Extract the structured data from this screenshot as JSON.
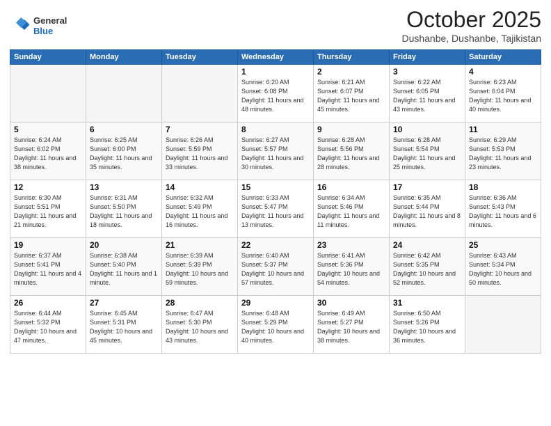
{
  "header": {
    "logo_line1": "General",
    "logo_line2": "Blue",
    "month_title": "October 2025",
    "location": "Dushanbe, Dushanbe, Tajikistan"
  },
  "days_of_week": [
    "Sunday",
    "Monday",
    "Tuesday",
    "Wednesday",
    "Thursday",
    "Friday",
    "Saturday"
  ],
  "weeks": [
    [
      {
        "day": "",
        "info": ""
      },
      {
        "day": "",
        "info": ""
      },
      {
        "day": "",
        "info": ""
      },
      {
        "day": "1",
        "info": "Sunrise: 6:20 AM\nSunset: 6:08 PM\nDaylight: 11 hours\nand 48 minutes."
      },
      {
        "day": "2",
        "info": "Sunrise: 6:21 AM\nSunset: 6:07 PM\nDaylight: 11 hours\nand 45 minutes."
      },
      {
        "day": "3",
        "info": "Sunrise: 6:22 AM\nSunset: 6:05 PM\nDaylight: 11 hours\nand 43 minutes."
      },
      {
        "day": "4",
        "info": "Sunrise: 6:23 AM\nSunset: 6:04 PM\nDaylight: 11 hours\nand 40 minutes."
      }
    ],
    [
      {
        "day": "5",
        "info": "Sunrise: 6:24 AM\nSunset: 6:02 PM\nDaylight: 11 hours\nand 38 minutes."
      },
      {
        "day": "6",
        "info": "Sunrise: 6:25 AM\nSunset: 6:00 PM\nDaylight: 11 hours\nand 35 minutes."
      },
      {
        "day": "7",
        "info": "Sunrise: 6:26 AM\nSunset: 5:59 PM\nDaylight: 11 hours\nand 33 minutes."
      },
      {
        "day": "8",
        "info": "Sunrise: 6:27 AM\nSunset: 5:57 PM\nDaylight: 11 hours\nand 30 minutes."
      },
      {
        "day": "9",
        "info": "Sunrise: 6:28 AM\nSunset: 5:56 PM\nDaylight: 11 hours\nand 28 minutes."
      },
      {
        "day": "10",
        "info": "Sunrise: 6:28 AM\nSunset: 5:54 PM\nDaylight: 11 hours\nand 25 minutes."
      },
      {
        "day": "11",
        "info": "Sunrise: 6:29 AM\nSunset: 5:53 PM\nDaylight: 11 hours\nand 23 minutes."
      }
    ],
    [
      {
        "day": "12",
        "info": "Sunrise: 6:30 AM\nSunset: 5:51 PM\nDaylight: 11 hours\nand 21 minutes."
      },
      {
        "day": "13",
        "info": "Sunrise: 6:31 AM\nSunset: 5:50 PM\nDaylight: 11 hours\nand 18 minutes."
      },
      {
        "day": "14",
        "info": "Sunrise: 6:32 AM\nSunset: 5:49 PM\nDaylight: 11 hours\nand 16 minutes."
      },
      {
        "day": "15",
        "info": "Sunrise: 6:33 AM\nSunset: 5:47 PM\nDaylight: 11 hours\nand 13 minutes."
      },
      {
        "day": "16",
        "info": "Sunrise: 6:34 AM\nSunset: 5:46 PM\nDaylight: 11 hours\nand 11 minutes."
      },
      {
        "day": "17",
        "info": "Sunrise: 6:35 AM\nSunset: 5:44 PM\nDaylight: 11 hours\nand 8 minutes."
      },
      {
        "day": "18",
        "info": "Sunrise: 6:36 AM\nSunset: 5:43 PM\nDaylight: 11 hours\nand 6 minutes."
      }
    ],
    [
      {
        "day": "19",
        "info": "Sunrise: 6:37 AM\nSunset: 5:41 PM\nDaylight: 11 hours\nand 4 minutes."
      },
      {
        "day": "20",
        "info": "Sunrise: 6:38 AM\nSunset: 5:40 PM\nDaylight: 11 hours\nand 1 minute."
      },
      {
        "day": "21",
        "info": "Sunrise: 6:39 AM\nSunset: 5:39 PM\nDaylight: 10 hours\nand 59 minutes."
      },
      {
        "day": "22",
        "info": "Sunrise: 6:40 AM\nSunset: 5:37 PM\nDaylight: 10 hours\nand 57 minutes."
      },
      {
        "day": "23",
        "info": "Sunrise: 6:41 AM\nSunset: 5:36 PM\nDaylight: 10 hours\nand 54 minutes."
      },
      {
        "day": "24",
        "info": "Sunrise: 6:42 AM\nSunset: 5:35 PM\nDaylight: 10 hours\nand 52 minutes."
      },
      {
        "day": "25",
        "info": "Sunrise: 6:43 AM\nSunset: 5:34 PM\nDaylight: 10 hours\nand 50 minutes."
      }
    ],
    [
      {
        "day": "26",
        "info": "Sunrise: 6:44 AM\nSunset: 5:32 PM\nDaylight: 10 hours\nand 47 minutes."
      },
      {
        "day": "27",
        "info": "Sunrise: 6:45 AM\nSunset: 5:31 PM\nDaylight: 10 hours\nand 45 minutes."
      },
      {
        "day": "28",
        "info": "Sunrise: 6:47 AM\nSunset: 5:30 PM\nDaylight: 10 hours\nand 43 minutes."
      },
      {
        "day": "29",
        "info": "Sunrise: 6:48 AM\nSunset: 5:29 PM\nDaylight: 10 hours\nand 40 minutes."
      },
      {
        "day": "30",
        "info": "Sunrise: 6:49 AM\nSunset: 5:27 PM\nDaylight: 10 hours\nand 38 minutes."
      },
      {
        "day": "31",
        "info": "Sunrise: 6:50 AM\nSunset: 5:26 PM\nDaylight: 10 hours\nand 36 minutes."
      },
      {
        "day": "",
        "info": ""
      }
    ]
  ]
}
